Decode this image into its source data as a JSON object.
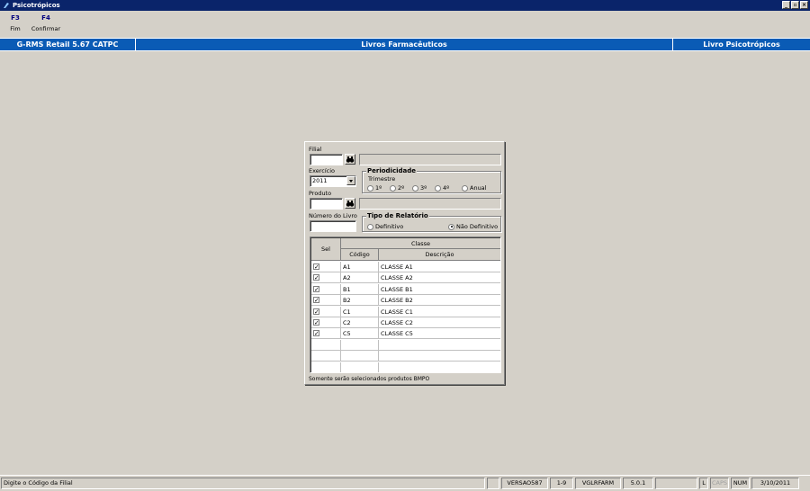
{
  "window": {
    "title": "Psicotrópicos"
  },
  "toolbar": [
    {
      "key": "F3",
      "label": "Fim"
    },
    {
      "key": "F4",
      "label": "Confirmar"
    }
  ],
  "band": {
    "left": "G-RMS Retail 5.67 CATPC",
    "center": "Livros Farmacêuticos",
    "right": "Livro Psicotrópicos"
  },
  "form": {
    "filial_label": "Filial",
    "filial_value": "",
    "exercicio_label": "Exercício",
    "exercicio_value": "2011",
    "periodicidade_title": "Periodicidade",
    "trimestre_label": "Trimestre",
    "trimestre_options": [
      "1º",
      "2º",
      "3º",
      "4º",
      "Anual"
    ],
    "produto_label": "Produto",
    "produto_value": "",
    "numero_livro_label": "Número do Livro",
    "numero_livro_value": "",
    "tipo_relatorio_title": "Tipo de Relatório",
    "tipo_options": [
      "Definitivo",
      "Não Definitivo"
    ],
    "tipo_selected": "Não Definitivo"
  },
  "grid": {
    "sel_header": "Sel",
    "group_header": "Classe",
    "col_codigo": "Código",
    "col_descricao": "Descrição",
    "rows": [
      {
        "sel": true,
        "codigo": "A1",
        "descricao": "CLASSE A1"
      },
      {
        "sel": true,
        "codigo": "A2",
        "descricao": "CLASSE A2"
      },
      {
        "sel": true,
        "codigo": "B1",
        "descricao": "CLASSE B1"
      },
      {
        "sel": true,
        "codigo": "B2",
        "descricao": "CLASSE B2"
      },
      {
        "sel": true,
        "codigo": "C1",
        "descricao": "CLASSE C1"
      },
      {
        "sel": true,
        "codigo": "C2",
        "descricao": "CLASSE C2"
      },
      {
        "sel": true,
        "codigo": "C5",
        "descricao": "CLASSE C5"
      }
    ],
    "note": "Somente serão selecionados produtos BMPO"
  },
  "status": {
    "message": "Digite o Código da Filial",
    "version": "VERSAO587",
    "code": "1-9",
    "module": "VGLRFARM",
    "build": "5.0.1",
    "l": "L",
    "caps": "CAPS",
    "num": "NUM",
    "date": "3/10/2011"
  },
  "colors": {
    "titlebar": "#0a246a",
    "band": "#0a5bb5",
    "face": "#d4d0c8",
    "toolbar_key": "#000080"
  }
}
